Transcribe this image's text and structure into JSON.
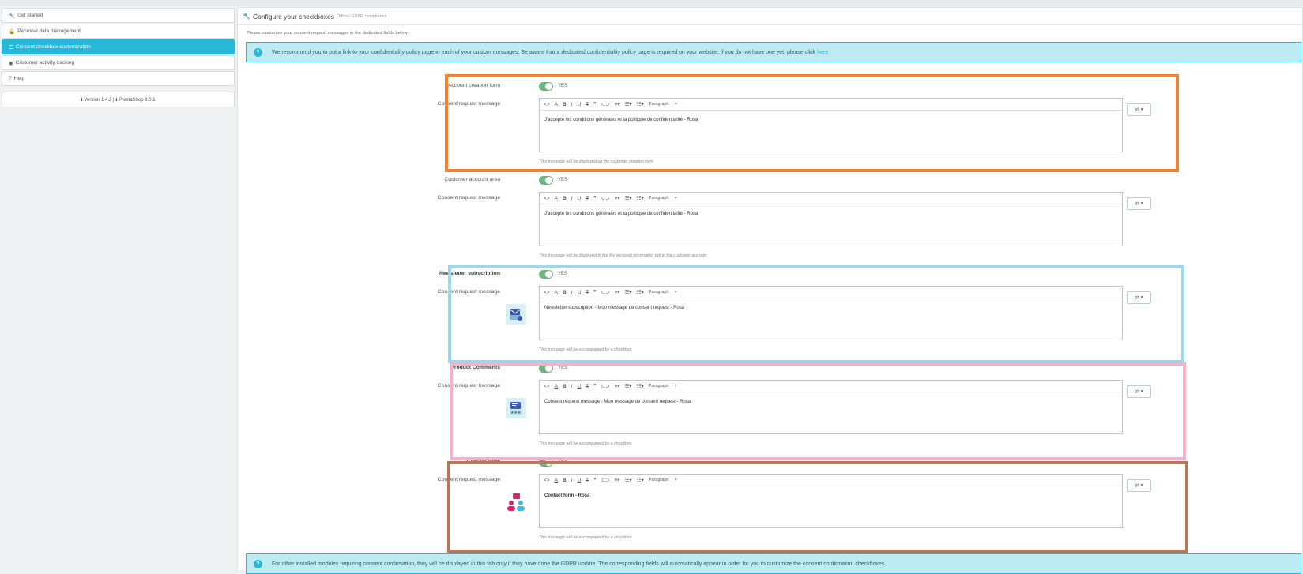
{
  "sidebar": {
    "items": [
      {
        "label": "Get started",
        "icon": "wrench-icon",
        "glyph": "🔧"
      },
      {
        "label": "Personal data management",
        "icon": "lock-icon",
        "glyph": "🔒"
      },
      {
        "label": "Consent checkbox customization",
        "icon": "list-icon",
        "glyph": "☰"
      },
      {
        "label": "Customer activity tracking",
        "icon": "user-circle-icon",
        "glyph": "◉"
      },
      {
        "label": "Help",
        "icon": "question-icon",
        "glyph": "?"
      }
    ],
    "version": "ℹ Version 1.4.2 | ℹ PrestaShop 8.0.1"
  },
  "panel": {
    "title": "Configure your checkboxes",
    "subtitle": "Official GDPR compliance",
    "intro": "Please customize your consent request messages in the dedicated fields below :",
    "top_alert": "We recommend you to put a link to your confidentiality policy page in each of your custom messages. Be aware that a dedicated confidentiality policy page is required on your website; if you do not have one yet, please click",
    "top_alert_link": "here.",
    "bottom_alert": "For other installed modules requiring consent confirmation, they will be displayed in this tab only if they have done the GDPR update. The corresponding fields will automatically appear in order for you to customize the consent confirmation checkboxes."
  },
  "common": {
    "yes": "YES",
    "consent_label": "Consent request message",
    "paragraph": "Paragraph",
    "lang": "gb"
  },
  "sections": [
    {
      "label": "Account creation form",
      "content": "J'accepte les conditions générales et la politique de confidentialité - Rosa",
      "help": "This message will be displayed on the customer creation form"
    },
    {
      "label": "Customer account area",
      "content": "J'accepte les conditions générales et la politique de confidentialité - Rosa",
      "help": "This message will be displayed in the My personal information tab in the customer account"
    },
    {
      "label": "Newsletter subscription",
      "content": "Newsletter subscription - Mon message de consent request - Rosa",
      "help": "This message will be accompanied by a checkbox"
    },
    {
      "label": "Product Comments",
      "content": "Consent request message  - Mon message de consent request - Rosa",
      "help": "This message will be accompanied by a checkbox"
    },
    {
      "label": "Contact form",
      "content": "Contact form - Rosa",
      "help": "This message will be accompanied by a checkbox"
    }
  ],
  "colors": {
    "accent": "#25b9d7",
    "switch_on": "#70b580",
    "frame_orange": "#f28131",
    "frame_blue": "#9fd6e8",
    "frame_pink": "#f4b1cb",
    "frame_brown": "#b07a5e"
  }
}
